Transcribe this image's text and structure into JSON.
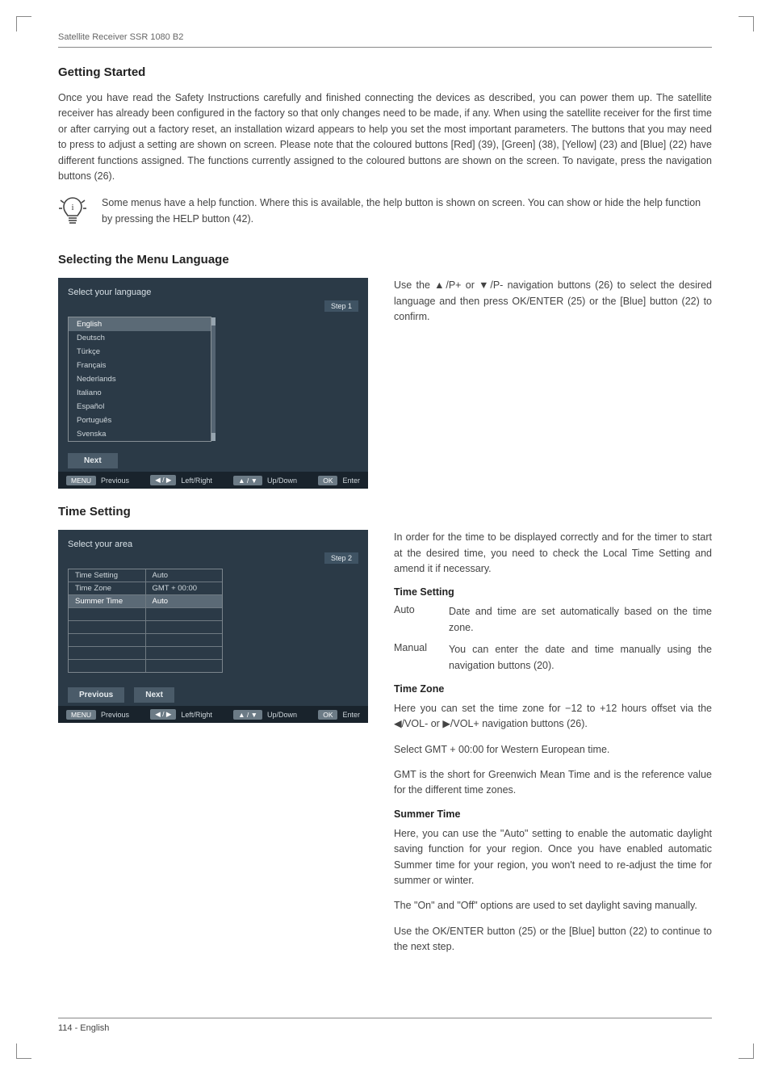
{
  "header": {
    "running_head": "Satellite Receiver SSR 1080 B2"
  },
  "getting_started": {
    "heading": "Getting Started",
    "intro": "Once you have read the Safety Instructions carefully and finished connecting the devices as described, you can power them up. The satellite receiver has already been configured in the factory so that only changes need to be made, if any. When using the satellite receiver for the first time or after carrying out a factory reset, an installation wizard appears to help you set the most important parameters. The buttons that you may need to press to adjust a setting are shown on screen. Please note that the coloured buttons [Red] (39), [Green] (38), [Yellow] (23) and [Blue] (22) have different functions assigned. The functions currently assigned to the coloured buttons are shown on the screen. To navigate, press the navigation buttons (26).",
    "tip": "Some menus have a help function. Where this is available, the help button is shown on screen. You can show or hide the help function by pressing the HELP button (42)."
  },
  "lang_section": {
    "heading": "Selecting the Menu Language",
    "screen": {
      "title": "Select your language",
      "step": "Step 1",
      "items": [
        "English",
        "Deutsch",
        "Türkçe",
        "Français",
        "Nederlands",
        "Italiano",
        "Español",
        "Português",
        "Svenska"
      ],
      "next_label": "Next",
      "keys": {
        "menu": "MENU",
        "menu_label": "Previous",
        "lr": "◀ / ▶",
        "lr_label": "Left/Right",
        "ud": "▲ / ▼",
        "ud_label": "Up/Down",
        "ok": "OK",
        "ok_label": "Enter"
      }
    },
    "desc": "Use the ▲/P+ or ▼/P- navigation buttons (26) to select the desired language and then press OK/ENTER (25) or the [Blue] button (22) to confirm."
  },
  "time_section": {
    "heading": "Time Setting",
    "screen": {
      "title": "Select your area",
      "step": "Step 2",
      "rows": [
        {
          "label": "Time Setting",
          "value": "Auto"
        },
        {
          "label": "Time Zone",
          "value": "GMT + 00:00"
        },
        {
          "label": "Summer Time",
          "value": "Auto"
        }
      ],
      "prev_label": "Previous",
      "next_label": "Next",
      "keys": {
        "menu": "MENU",
        "menu_label": "Previous",
        "lr": "◀ / ▶",
        "lr_label": "Left/Right",
        "ud": "▲ / ▼",
        "ud_label": "Up/Down",
        "ok": "OK",
        "ok_label": "Enter"
      }
    },
    "intro": "In order for the time to be displayed correctly and for the timer to start at the desired time, you need to  check  the Local Time Setting and amend it if necessary.",
    "setting_heading": "Time Setting",
    "defs": [
      {
        "term": "Auto",
        "desc": "Date and time are set automatically based on the time zone."
      },
      {
        "term": "Manual",
        "desc": "You can enter the date and time manually using the navigation buttons (20)."
      }
    ],
    "zone_heading": "Time Zone",
    "zone_p1": "Here you can set the time zone for −12 to +12 hours offset via the ◀/VOL- or ▶/VOL+ navigation buttons (26).",
    "zone_p2": "Select GMT + 00:00 for Western European time.",
    "zone_p3": "GMT is the short for Greenwich Mean Time and is the reference value for the different time zones.",
    "summer_heading": "Summer Time",
    "summer_p1": "Here, you can use the \"Auto\" setting to enable the automatic daylight saving function for your region. Once you have enabled automatic Summer time for your region, you won't need to re-adjust the time for summer or winter.",
    "summer_p2": "The \"On\" and \"Off\" options are used to set daylight saving manually.",
    "summer_p3": "Use the OK/ENTER button (25) or the [Blue] button (22) to continue to the next step."
  },
  "footer": {
    "page": "114 - English"
  }
}
